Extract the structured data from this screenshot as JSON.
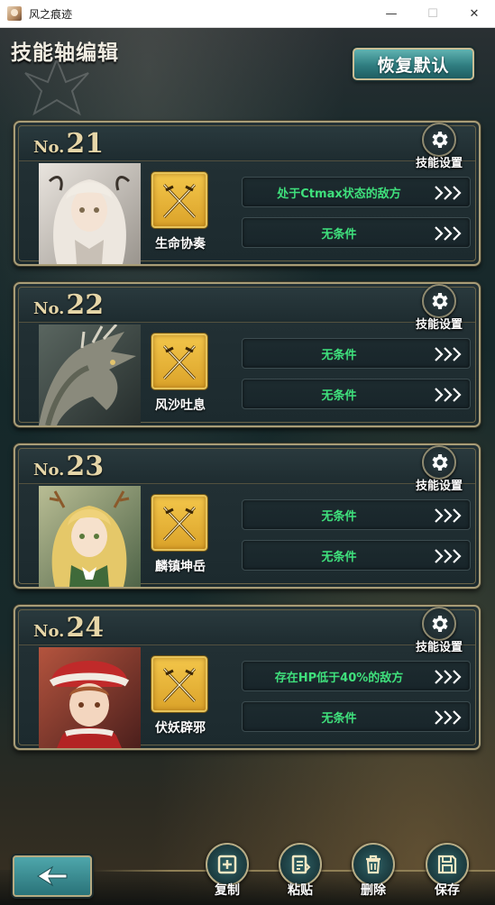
{
  "window": {
    "title": "风之痕迹",
    "minimize": "—",
    "maximize": "☐",
    "close": "✕"
  },
  "header": {
    "title": "技能轴编辑",
    "reset_label": "恢复默认"
  },
  "cards": [
    {
      "no_prefix": "No.",
      "number": "21",
      "settings_label": "技能设置",
      "skill_name": "生命协奏",
      "conditions": [
        "处于Ctmax状态的敌方",
        "无条件"
      ]
    },
    {
      "no_prefix": "No.",
      "number": "22",
      "settings_label": "技能设置",
      "skill_name": "风沙吐息",
      "conditions": [
        "无条件",
        "无条件"
      ]
    },
    {
      "no_prefix": "No.",
      "number": "23",
      "settings_label": "技能设置",
      "skill_name": "麟镇坤岳",
      "conditions": [
        "无条件",
        "无条件"
      ]
    },
    {
      "no_prefix": "No.",
      "number": "24",
      "settings_label": "技能设置",
      "skill_name": "伏妖辟邪",
      "conditions": [
        "存在HP低于40%的敌方",
        "无条件"
      ]
    }
  ],
  "actions": {
    "copy": "复制",
    "paste": "粘贴",
    "delete": "删除",
    "save": "保存"
  },
  "colors": {
    "condition_text": "#3fe07c",
    "accent_teal": "#2f7d80",
    "frame_gold": "#a99d77",
    "skill_icon_gold": "#f3c64a"
  },
  "icons": {
    "settings": "gear-icon",
    "skill": "crossed-swords-icon",
    "condition": "triple-chevron-right-icon",
    "back": "back-arrow-icon",
    "copy": "copy-icon",
    "paste": "paste-icon",
    "delete": "trash-icon",
    "save": "floppy-disk-icon"
  }
}
